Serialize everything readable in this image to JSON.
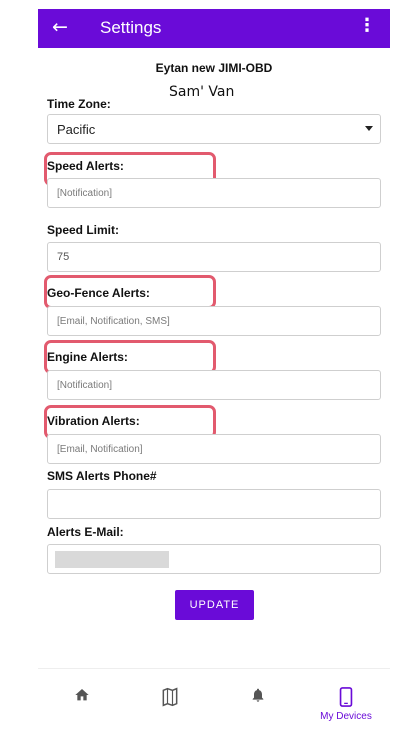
{
  "appbar": {
    "title": "Settings"
  },
  "device": {
    "name": "Eytan new JIMI-OBD",
    "nickname": "Sam' Van"
  },
  "fields": {
    "time_zone": {
      "label": "Time Zone:",
      "value": "Pacific"
    },
    "speed_alerts": {
      "label": "Speed Alerts:",
      "value": "[Notification]"
    },
    "speed_limit": {
      "label": "Speed Limit:",
      "value": "75"
    },
    "geofence_alerts": {
      "label": "Geo-Fence Alerts:",
      "value": "[Email, Notification, SMS]"
    },
    "engine_alerts": {
      "label": "Engine Alerts:",
      "value": "[Notification]"
    },
    "vibration_alerts": {
      "label": "Vibration Alerts:",
      "value": "[Email, Notification]"
    },
    "sms_phone": {
      "label": "SMS Alerts Phone#",
      "value": ""
    },
    "alerts_email": {
      "label": "Alerts E-Mail:",
      "value": ""
    }
  },
  "actions": {
    "update_label": "UPDATE"
  },
  "nav": {
    "items": [
      {
        "icon": "home-icon"
      },
      {
        "icon": "map-icon"
      },
      {
        "icon": "bell-icon"
      },
      {
        "icon": "phone-icon",
        "label": "My Devices"
      }
    ]
  },
  "colors": {
    "primary": "#6a0bd8",
    "highlight": "#e25a6e"
  }
}
